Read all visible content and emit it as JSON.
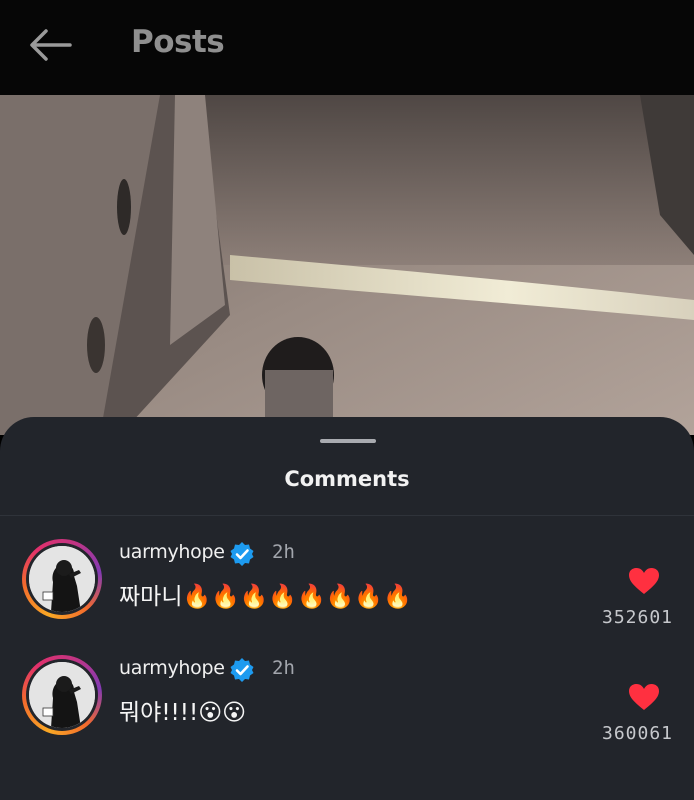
{
  "header": {
    "back_icon": "arrow-left-icon",
    "title": "Posts"
  },
  "post": {
    "media_description_icon": "photo-placeholder"
  },
  "comments_sheet": {
    "title": "Comments",
    "items": [
      {
        "username": "uarmyhope",
        "verified_icon": "verified-badge-icon",
        "time": "2h",
        "text": "짜마니🔥🔥🔥🔥🔥🔥🔥🔥",
        "like_icon": "heart-icon",
        "likes": "352601"
      },
      {
        "username": "uarmyhope",
        "verified_icon": "verified-badge-icon",
        "time": "2h",
        "text": "뭐야!!!!😮😮",
        "like_icon": "heart-icon",
        "likes": "360061"
      }
    ]
  },
  "colors": {
    "header_bg": "#060606",
    "sheet_bg": "#22252b",
    "verified_blue": "#1d9bf0",
    "like_red": "#ff3040"
  }
}
